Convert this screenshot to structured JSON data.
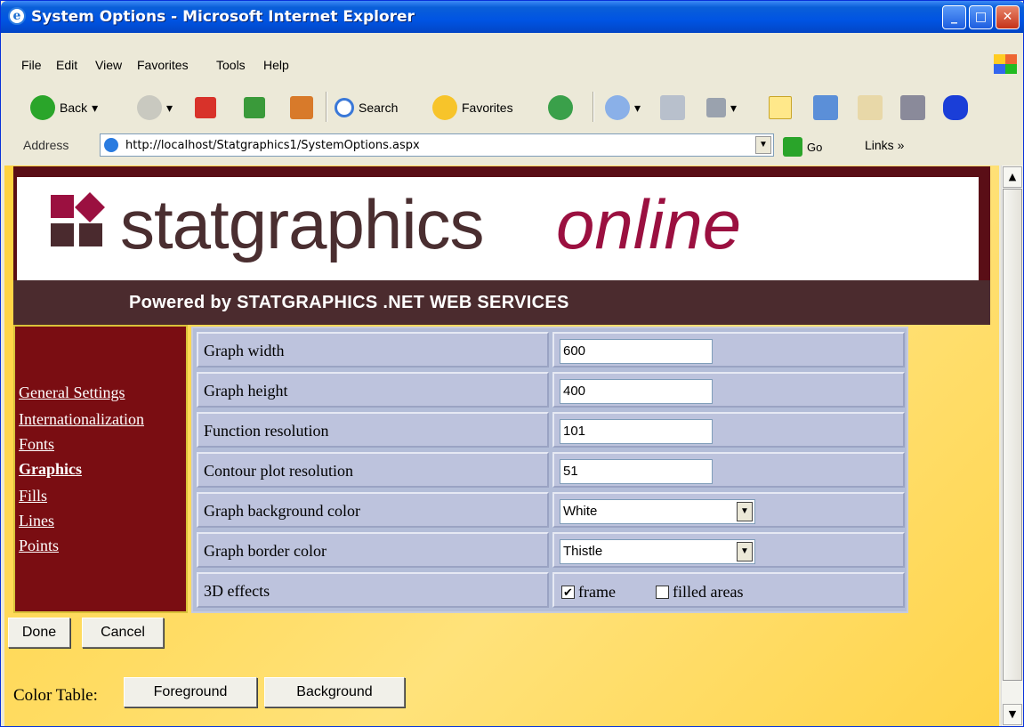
{
  "window": {
    "title": "System Options - Microsoft Internet Explorer"
  },
  "menu": [
    "File",
    "Edit",
    "View",
    "Favorites",
    "Tools",
    "Help"
  ],
  "toolbar": {
    "back": "Back",
    "search": "Search",
    "favorites": "Favorites"
  },
  "address": {
    "label": "Address",
    "url": "http://localhost/Statgraphics1/SystemOptions.aspx",
    "go": "Go",
    "links": "Links"
  },
  "banner": {
    "brand": "statgraphics",
    "online": "online",
    "powered": "Powered by STATGRAPHICS .NET WEB SERVICES"
  },
  "nav": [
    "General Settings",
    "Internationalization",
    "Fonts",
    "Graphics",
    "Fills",
    "Lines",
    "Points"
  ],
  "settings": {
    "graph_width": {
      "label": "Graph width",
      "value": "600"
    },
    "graph_height": {
      "label": "Graph height",
      "value": "400"
    },
    "function_resolution": {
      "label": "Function resolution",
      "value": "101"
    },
    "contour_resolution": {
      "label": "Contour plot resolution",
      "value": "51"
    },
    "bg_color": {
      "label": "Graph background color",
      "value": "White"
    },
    "border_color": {
      "label": "Graph border color",
      "value": "Thistle"
    },
    "effects": {
      "label": "3D effects",
      "frame": "frame",
      "filled": "filled areas"
    }
  },
  "buttons": {
    "done": "Done",
    "cancel": "Cancel",
    "foreground": "Foreground",
    "background": "Background"
  },
  "color_table": "Color Table:"
}
